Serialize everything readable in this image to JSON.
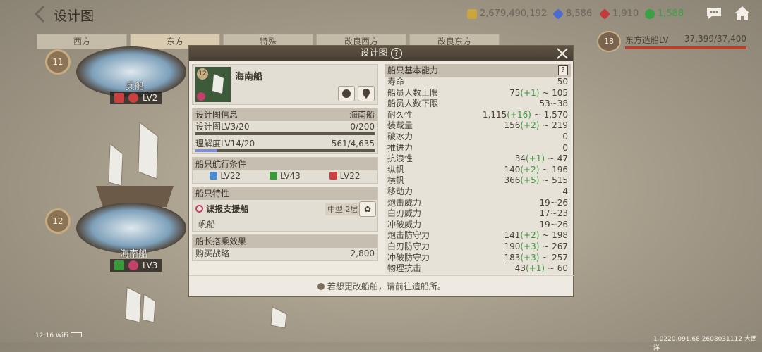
{
  "header": {
    "title": "设计图"
  },
  "resources": [
    {
      "icon": "gold-coin-icon",
      "value": "2,679,490,192",
      "color": "#c9a640"
    },
    {
      "icon": "blue-gem-icon",
      "value": "8,586",
      "color": "#4a6ad0"
    },
    {
      "icon": "red-gem-icon",
      "value": "1,910",
      "color": "#c23a3a"
    },
    {
      "icon": "green-token-icon",
      "value": "1,588",
      "color": "#3aa045"
    }
  ],
  "tabs": [
    "西方",
    "东方",
    "特殊",
    "改良西方",
    "改良东方"
  ],
  "shipyard": {
    "badge": "18",
    "label": "东方造船LV",
    "value": "37,399/37,400",
    "progress": 0.9997
  },
  "ships": [
    {
      "name": "兵船",
      "level": "LV2",
      "ring": "11"
    },
    {
      "name": "海南船",
      "level": "LV3",
      "ring": "12"
    }
  ],
  "modal": {
    "title": "设计图",
    "help": "?",
    "ship": {
      "badge": "12",
      "name": "海南船"
    },
    "blueprint": {
      "header": "设计图信息",
      "header_value": "海南船",
      "lv_label": "设计图LV3/20",
      "lv_value": "0/200",
      "lv_progress": 0,
      "und_label": "理解度LV14/20",
      "und_value": "561/4,635",
      "und_progress": 0.121
    },
    "conditions": {
      "header": "船只航行条件",
      "items": [
        "LV22",
        "LV43",
        "LV22"
      ]
    },
    "traits": {
      "header": "船只特性",
      "name": "谍报支援船",
      "size": "中型 2层",
      "type": "帆船"
    },
    "captain": {
      "header": "船长搭乘效果",
      "label": "购买战略",
      "value": "2,800"
    },
    "abilities": {
      "header": "船只基本能力",
      "help": "?",
      "stats": [
        {
          "n": "寿命",
          "v": "50",
          "g": ""
        },
        {
          "n": "船员人数上限",
          "v": "75",
          "g": "(+1)",
          "r": " ~ 105"
        },
        {
          "n": "船员人数下限",
          "v": "53~38",
          "g": ""
        },
        {
          "n": "耐久性",
          "v": "1,115",
          "g": "(+16)",
          "r": " ~ 1,570"
        },
        {
          "n": "装载量",
          "v": "156",
          "g": "(+2)",
          "r": " ~ 219"
        },
        {
          "n": "破冰力",
          "v": "0",
          "g": ""
        },
        {
          "n": "推进力",
          "v": "0",
          "g": ""
        },
        {
          "n": "抗浪性",
          "v": "34",
          "g": "(+1)",
          "r": " ~ 47"
        },
        {
          "n": "纵帆",
          "v": "140",
          "g": "(+2)",
          "r": " ~ 196"
        },
        {
          "n": "横帆",
          "v": "366",
          "g": "(+5)",
          "r": " ~ 515"
        },
        {
          "n": "移动力",
          "v": "4",
          "g": ""
        },
        {
          "n": "炮击威力",
          "v": "19~26",
          "g": ""
        },
        {
          "n": "白刃威力",
          "v": "17~23",
          "g": ""
        },
        {
          "n": "冲破威力",
          "v": "19~26",
          "g": ""
        },
        {
          "n": "炮击防守力",
          "v": "141",
          "g": "(+2)",
          "r": " ~ 198"
        },
        {
          "n": "白刃防守力",
          "v": "190",
          "g": "(+3)",
          "r": " ~ 267"
        },
        {
          "n": "冲破防守力",
          "v": "183",
          "g": "(+3)",
          "r": " ~ 257"
        },
        {
          "n": "物理抗击",
          "v": "43",
          "g": "(+1)",
          "r": " ~ 60"
        }
      ]
    },
    "footer": "若想更改船舶，请前往造船所。"
  },
  "status": {
    "time": "12:16",
    "wifi": "WiFi"
  },
  "version": "1.0220.091.68 2608031112 大西洋"
}
